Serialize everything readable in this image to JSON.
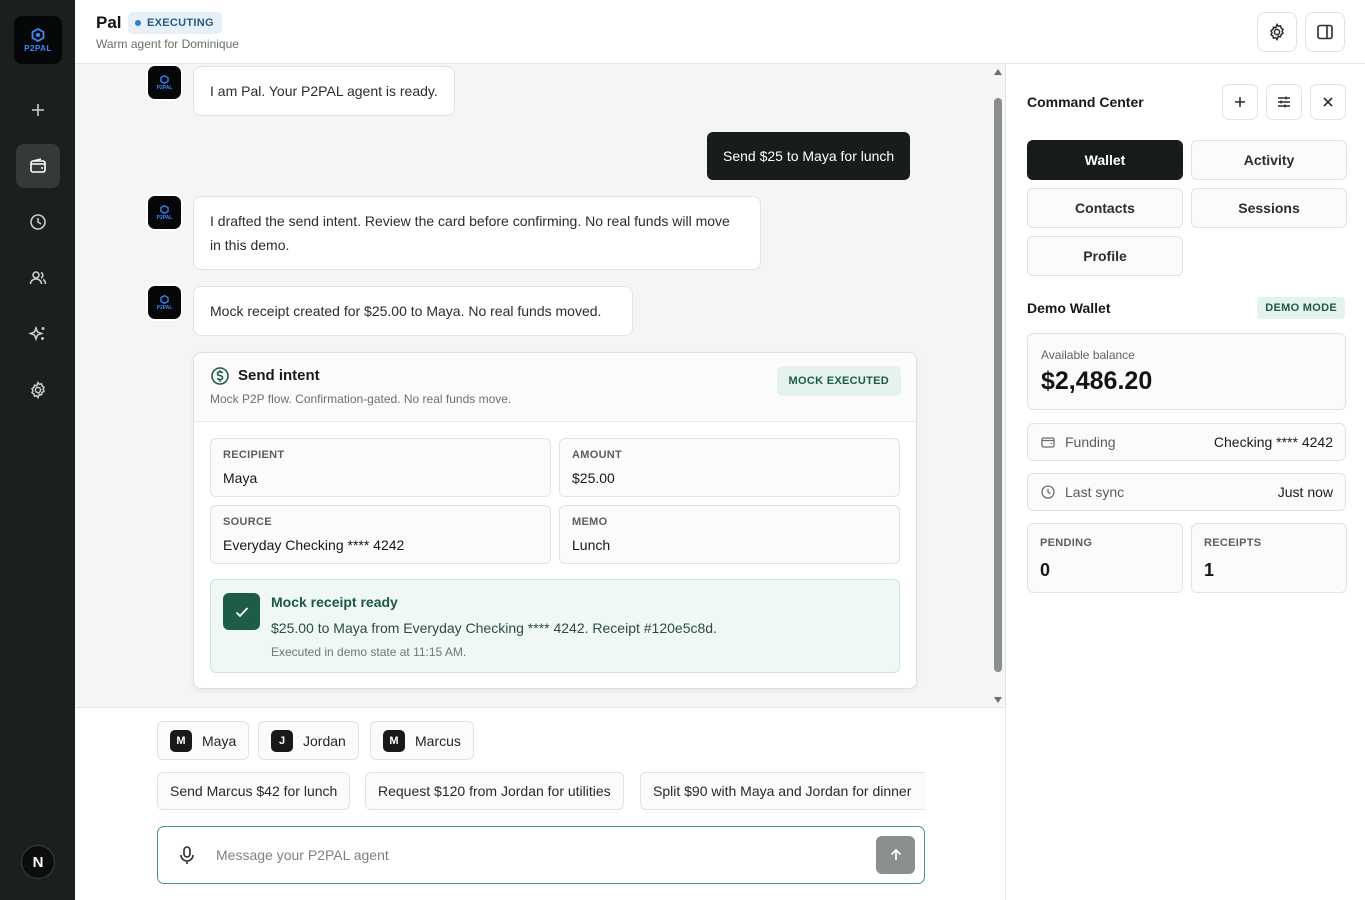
{
  "rail": {
    "logo_text": "P2PAL",
    "user_initial": "N"
  },
  "header": {
    "title": "Pal",
    "status": "EXECUTING",
    "subtitle": "Warm agent for Dominique"
  },
  "chat": {
    "messages": [
      {
        "role": "agent",
        "text": "I am Pal. Your P2PAL agent is ready."
      },
      {
        "role": "user",
        "text": "Send $25 to Maya for lunch"
      },
      {
        "role": "agent",
        "text": "I drafted the send intent. Review the card before confirming. No real funds will move in this demo."
      },
      {
        "role": "agent",
        "text": "Mock receipt created for $25.00 to Maya. No real funds moved."
      }
    ],
    "card": {
      "title": "Send intent",
      "subtitle": "Mock P2P flow. Confirmation-gated. No real funds move.",
      "badge": "MOCK EXECUTED",
      "fields": [
        {
          "label": "RECIPIENT",
          "value": "Maya"
        },
        {
          "label": "AMOUNT",
          "value": "$25.00"
        },
        {
          "label": "SOURCE",
          "value": "Everyday Checking **** 4242"
        },
        {
          "label": "MEMO",
          "value": "Lunch"
        }
      ],
      "receipt": {
        "title": "Mock receipt ready",
        "text": "$25.00 to Maya from Everyday Checking **** 4242. Receipt #120e5c8d.",
        "time": "Executed in demo state at 11:15 AM."
      }
    }
  },
  "composer": {
    "contacts": [
      {
        "initial": "M",
        "name": "Maya"
      },
      {
        "initial": "J",
        "name": "Jordan"
      },
      {
        "initial": "M",
        "name": "Marcus"
      }
    ],
    "suggestions": [
      "Send Marcus $42 for lunch",
      "Request $120 from Jordan for utilities",
      "Split $90 with Maya and Jordan for dinner"
    ],
    "placeholder": "Message your P2PAL agent"
  },
  "panel": {
    "title": "Command Center",
    "tabs": [
      "Wallet",
      "Activity",
      "Contacts",
      "Sessions",
      "Profile"
    ],
    "active_tab": "Wallet",
    "wallet": {
      "title": "Demo Wallet",
      "mode": "DEMO MODE",
      "balance_label": "Available balance",
      "balance": "$2,486.20",
      "funding_label": "Funding",
      "funding_value": "Checking **** 4242",
      "sync_label": "Last sync",
      "sync_value": "Just now",
      "pending_label": "PENDING",
      "pending_value": "0",
      "receipts_label": "RECEIPTS",
      "receipts_value": "1"
    }
  },
  "colors": {
    "rail_bg": "#1b1f1d",
    "accent_green": "#1d5c46",
    "status_blue": "#2f7fd1"
  }
}
